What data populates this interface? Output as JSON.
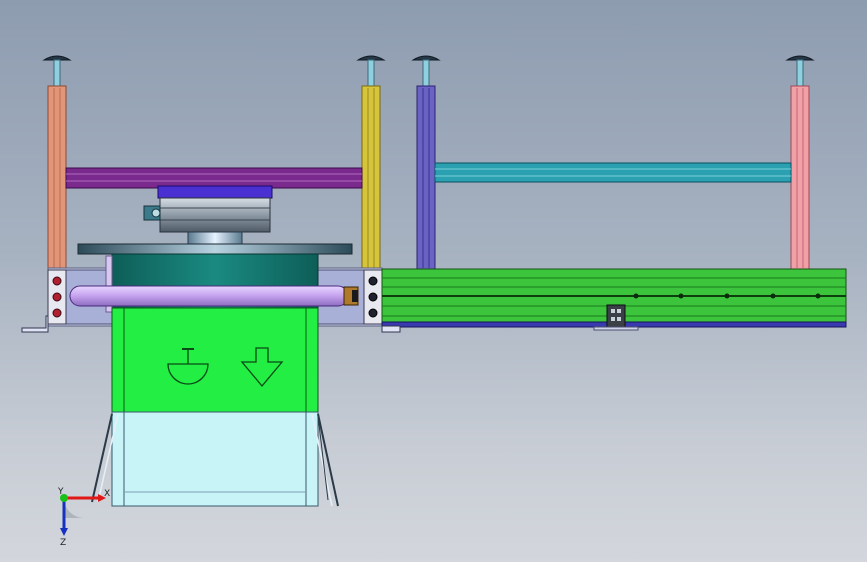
{
  "viewport": {
    "background_top": "#8e9cb0",
    "background_bottom": "#d3d6dc"
  },
  "colors": {
    "post_left": "#e3957a",
    "post_mid": "#d6c43b",
    "post_right_a": "#6b63c4",
    "post_right_b": "#f2a0a8",
    "beam_purple": "#7a2a8c",
    "beam_teal": "#2aa0b0",
    "conveyor_green": "#3cc43c",
    "hopper_green": "#22ee44",
    "bin_cyan": "#c8f4f8",
    "turntable_teal": "#137a70",
    "roller_lavender": "#c8a8f0",
    "motor_base_blue": "#4a30d0"
  },
  "icons": {
    "arrow_down_1": "arrow-down-icon",
    "arrow_down_2": "arrow-down-icon"
  },
  "triad": {
    "x_label": "X",
    "y_label": "Y",
    "z_label": "Z"
  }
}
